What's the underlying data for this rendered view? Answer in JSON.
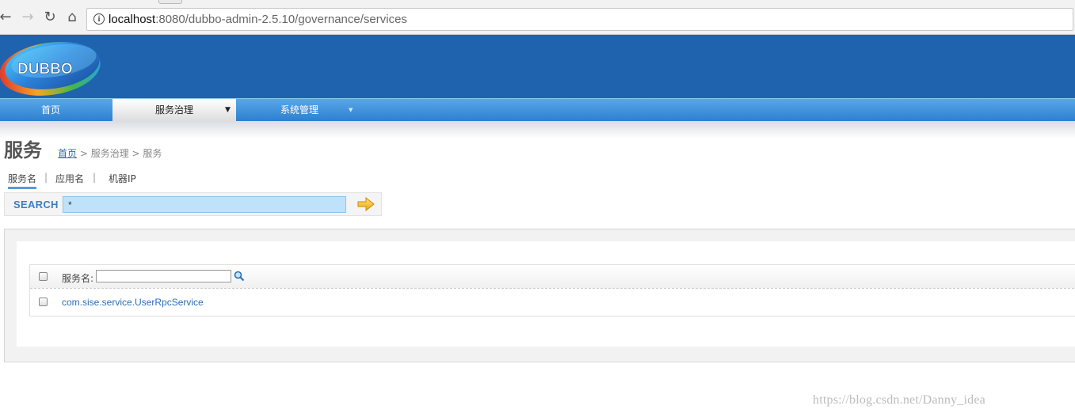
{
  "browser": {
    "url_host": "localhost",
    "url_rest": ":8080/dubbo-admin-2.5.10/governance/services",
    "back_glyph": "←",
    "forward_glyph": "→",
    "reload_glyph": "↻",
    "home_glyph": "⌂",
    "info_glyph": "i"
  },
  "header": {
    "logo_text": "DUBBO",
    "background_color": "#1f63ae"
  },
  "menu": {
    "items": [
      {
        "label": "首页"
      },
      {
        "label": "服务治理",
        "caret": "▼",
        "active": true
      },
      {
        "label": "系统管理",
        "caret": "▼"
      }
    ]
  },
  "page": {
    "title": "服务",
    "breadcrumb": {
      "home": "首页",
      "rest": " > 服务治理 > 服务"
    }
  },
  "subtabs": {
    "items": [
      "服务名",
      "应用名",
      "机器IP"
    ],
    "separator": "|"
  },
  "search": {
    "label": "SEARCH",
    "value": "*"
  },
  "table": {
    "header_label": "服务名:",
    "filter_value": "",
    "rows": [
      {
        "service": "com.sise.service.UserRpcService"
      }
    ]
  },
  "watermark": "https://blog.csdn.net/Danny_idea"
}
